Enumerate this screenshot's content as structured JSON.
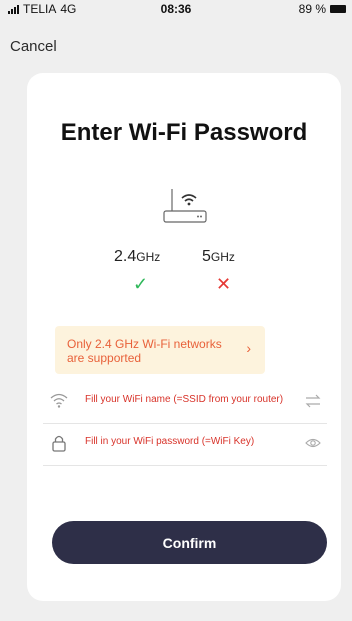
{
  "status_bar": {
    "carrier": "TELIA",
    "network": "4G",
    "time": "08:36",
    "battery": "89 %"
  },
  "nav": {
    "cancel_label": "Cancel"
  },
  "page": {
    "title": "Enter Wi-Fi Password",
    "bands": [
      {
        "label": "2.4",
        "unit": "GHz",
        "status": "✓",
        "status_color": "#2fb85a"
      },
      {
        "label": "5",
        "unit": "GHz",
        "status": "✕",
        "status_color": "#e53935"
      }
    ],
    "notice": {
      "text": "Only 2.4 GHz Wi-Fi networks are supported",
      "arrow": "›"
    },
    "ssid_field": {
      "placeholder": "Fill your WiFi name (=SSID from your router)",
      "icon": "wifi-icon",
      "side_icon": "swap-icon"
    },
    "password_field": {
      "placeholder": "Fill in your WiFi password (=WiFi Key)",
      "icon": "lock-icon",
      "side_icon": "eye-icon"
    },
    "confirm_label": "Confirm"
  },
  "colors": {
    "accent_dark": "#2e2f48",
    "warning": "#e8613a",
    "error_text": "#d8332a"
  }
}
